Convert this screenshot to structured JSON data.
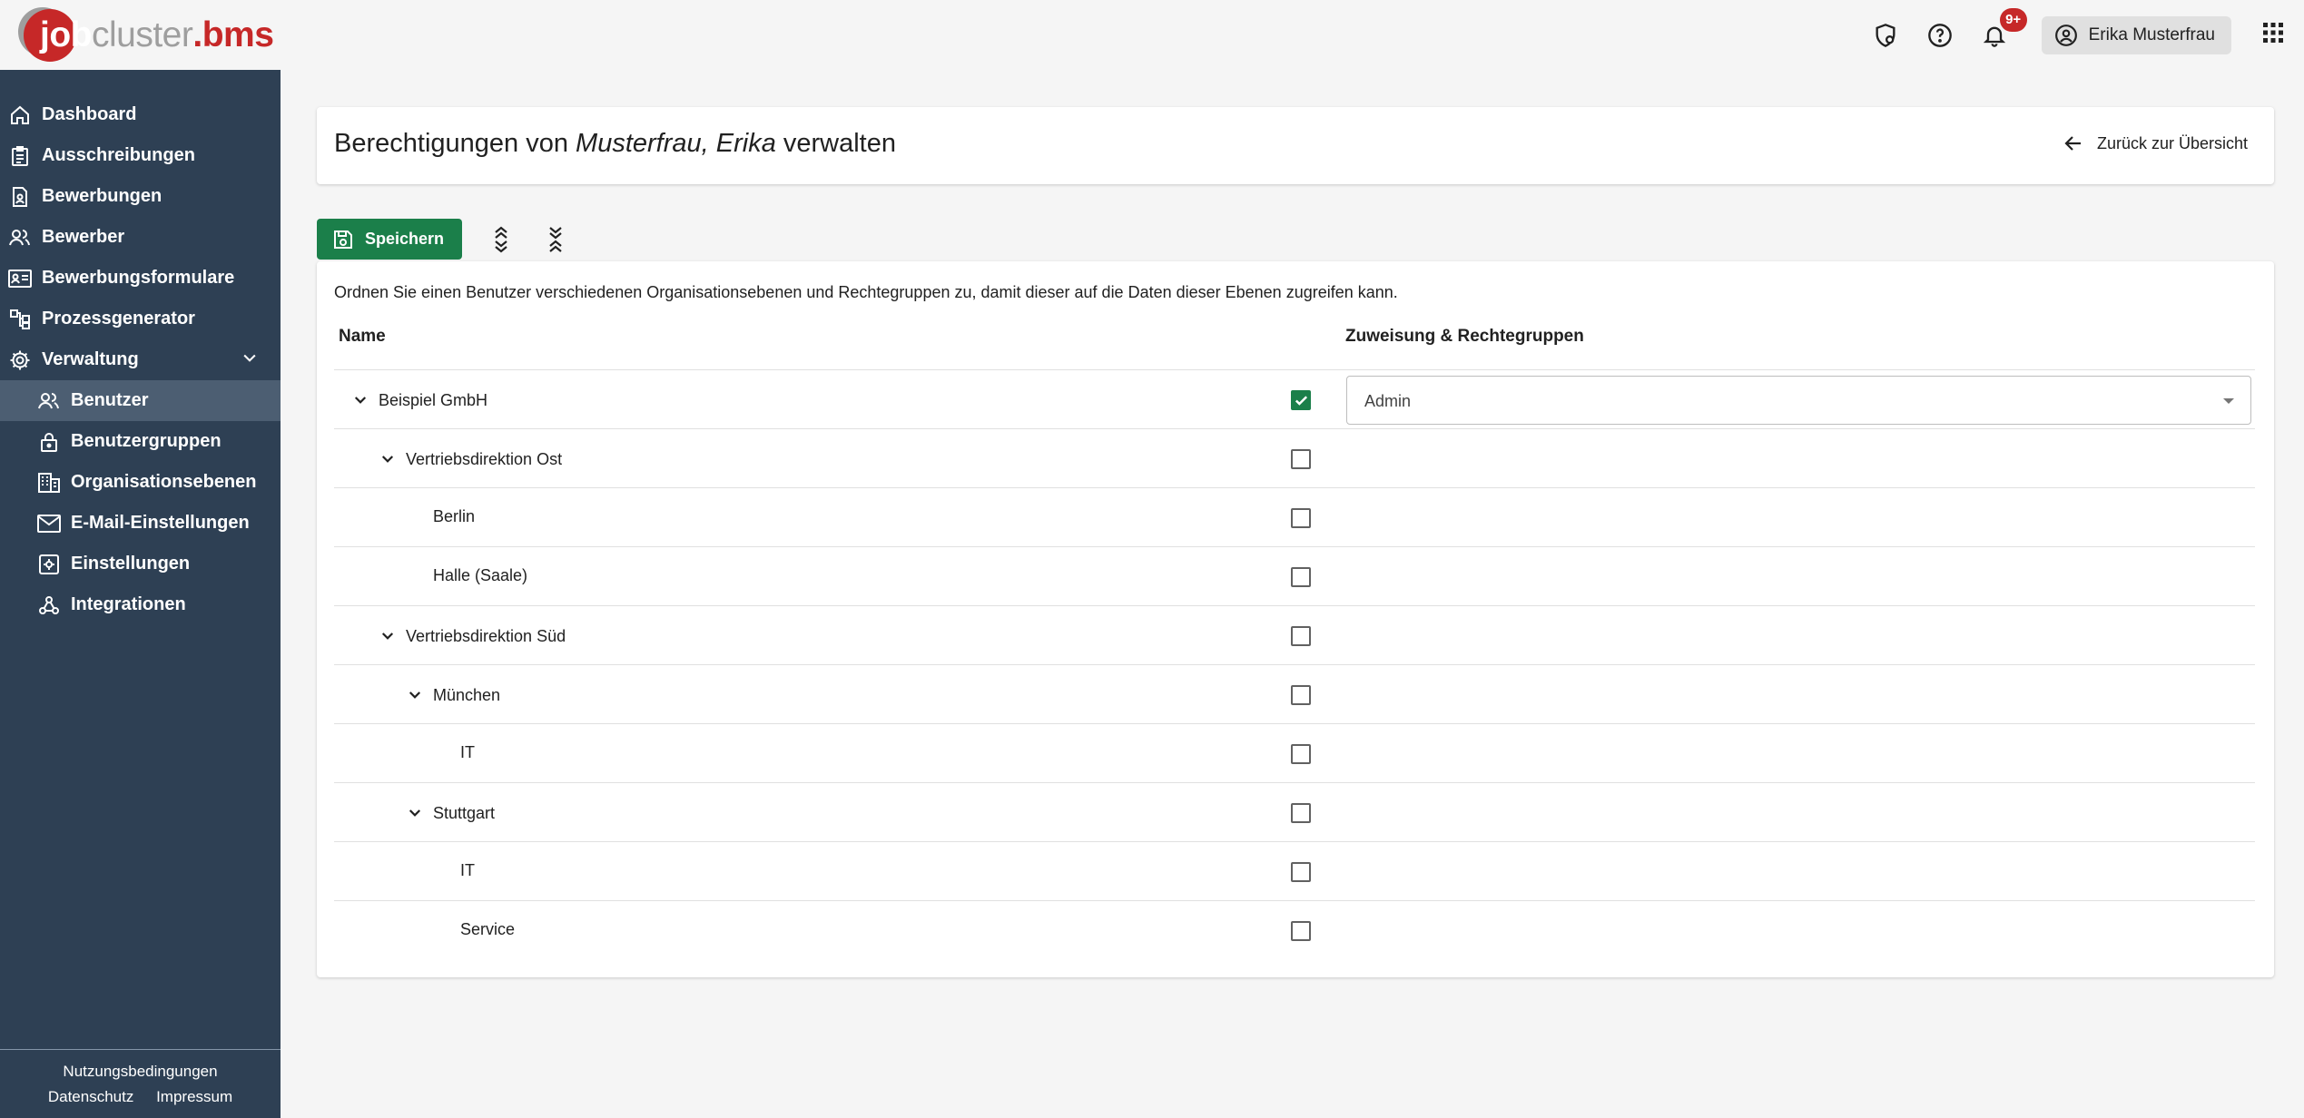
{
  "brand": {
    "part_job": "job",
    "part_cluster": "cluster",
    "part_dot": ".",
    "part_bms": "bms",
    "colors": {
      "primary": "#2e4054",
      "accent": "#c62828",
      "success": "#1b7f4a"
    }
  },
  "header": {
    "icons": [
      "shield-icon",
      "help-icon",
      "bell-icon",
      "apps-grid-icon"
    ],
    "notifications_badge": "9+",
    "user_name": "Erika Musterfrau"
  },
  "sidebar": {
    "items": [
      {
        "label": "Dashboard",
        "icon": "home-icon"
      },
      {
        "label": "Ausschreibungen",
        "icon": "clipboard-icon"
      },
      {
        "label": "Bewerbungen",
        "icon": "document-user-icon"
      },
      {
        "label": "Bewerber",
        "icon": "users-icon"
      },
      {
        "label": "Bewerbungsformulare",
        "icon": "id-card-icon"
      },
      {
        "label": "Prozessgenerator",
        "icon": "flow-icon"
      },
      {
        "label": "Verwaltung",
        "icon": "gear-icon",
        "expanded": true
      }
    ],
    "sub_items": [
      {
        "label": "Benutzer",
        "icon": "users-icon",
        "active": true
      },
      {
        "label": "Benutzergruppen",
        "icon": "lock-icon"
      },
      {
        "label": "Organisationsebenen",
        "icon": "building-icon"
      },
      {
        "label": "E-Mail-Einstellungen",
        "icon": "mail-icon"
      },
      {
        "label": "Einstellungen",
        "icon": "settings-box-icon"
      },
      {
        "label": "Integrationen",
        "icon": "webhook-icon"
      }
    ],
    "footer": {
      "terms": "Nutzungsbedingungen",
      "privacy": "Datenschutz",
      "imprint": "Impressum"
    }
  },
  "page": {
    "title_prefix": "Berechtigungen von ",
    "title_name": "Musterfrau, Erika",
    "title_suffix": " verwalten",
    "back_label": "Zurück zur Übersicht",
    "save_label": "Speichern",
    "description": "Ordnen Sie einen Benutzer verschiedenen Organisationsebenen und Rechtegruppen zu, damit dieser auf die Daten dieser Ebenen zugreifen kann."
  },
  "table": {
    "col_name": "Name",
    "col_assignment": "Zuweisung & Rechtegruppen",
    "rows": [
      {
        "name": "Beispiel GmbH",
        "level": 0,
        "expandable": true,
        "checked": true,
        "role": "Admin"
      },
      {
        "name": "Vertriebsdirektion Ost",
        "level": 1,
        "expandable": true,
        "checked": false
      },
      {
        "name": "Berlin",
        "level": 2,
        "expandable": false,
        "checked": false
      },
      {
        "name": "Halle (Saale)",
        "level": 2,
        "expandable": false,
        "checked": false
      },
      {
        "name": "Vertriebsdirektion Süd",
        "level": 1,
        "expandable": true,
        "checked": false
      },
      {
        "name": "München",
        "level": 2,
        "expandable": true,
        "checked": false
      },
      {
        "name": "IT",
        "level": 3,
        "expandable": false,
        "checked": false
      },
      {
        "name": "Stuttgart",
        "level": 2,
        "expandable": true,
        "checked": false
      },
      {
        "name": "IT",
        "level": 3,
        "expandable": false,
        "checked": false
      },
      {
        "name": "Service",
        "level": 3,
        "expandable": false,
        "checked": false
      }
    ]
  }
}
